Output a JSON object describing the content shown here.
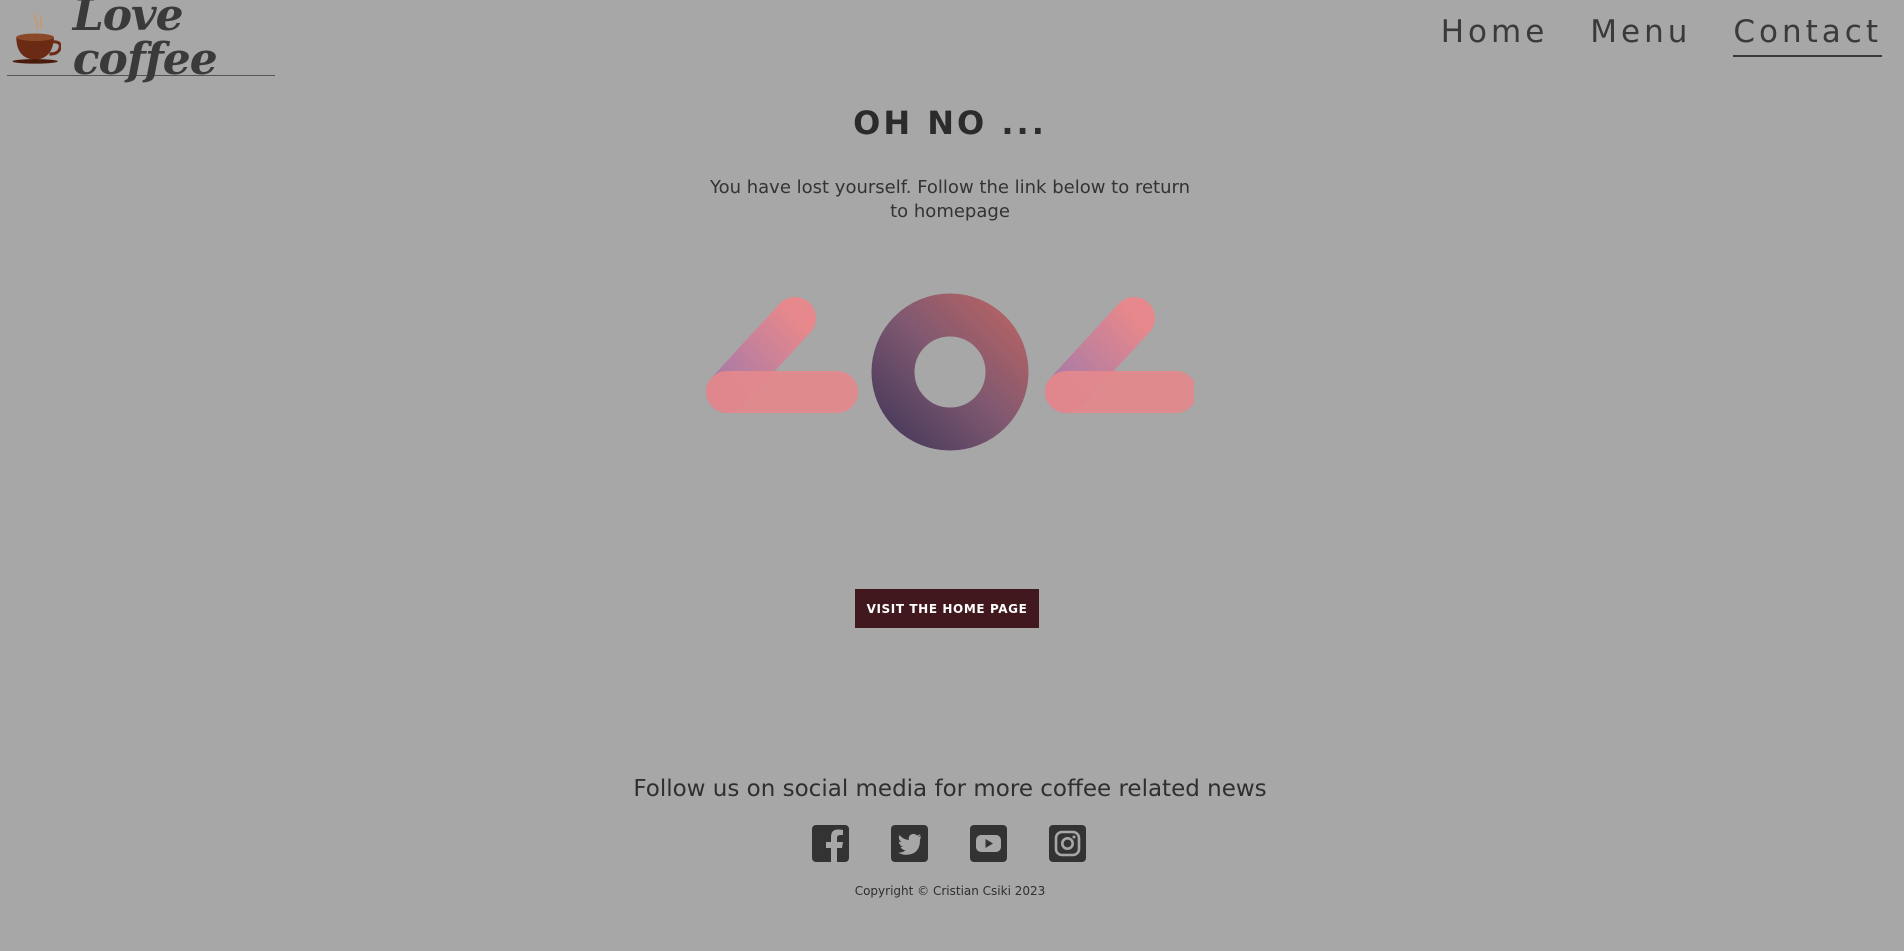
{
  "header": {
    "logo_text": "Love coffee",
    "nav": [
      {
        "label": "Home",
        "active": false
      },
      {
        "label": "Menu",
        "active": false
      },
      {
        "label": "Contact",
        "active": true
      }
    ]
  },
  "main": {
    "title": "OH NO ...",
    "message": "You have lost yourself. Follow the link below to return to homepage",
    "error_code": "404",
    "button_label": "VISIT THE HOME PAGE"
  },
  "footer": {
    "follow_text": "Follow us on social media for more coffee related news",
    "socials": [
      "facebook-icon",
      "twitter-icon",
      "youtube-icon",
      "instagram-icon"
    ],
    "copyright": "Copyright © Cristian Csiki 2023"
  },
  "colors": {
    "background": "#a7a7a7",
    "text": "#333333",
    "button": "#41181d",
    "accent_pink": "#e6888c",
    "accent_purple": "#a87aa6",
    "zero_dark": "#5a4866"
  }
}
